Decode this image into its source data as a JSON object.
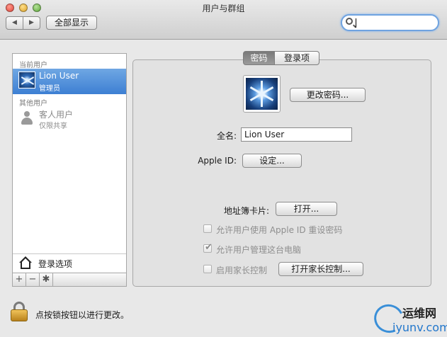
{
  "window": {
    "title": "用户与群组"
  },
  "toolbar": {
    "back": "◀",
    "forward": "▶",
    "show_all": "全部显示",
    "search_placeholder": ""
  },
  "sidebar": {
    "current_users_label": "当前用户",
    "other_users_label": "其他用户",
    "users": [
      {
        "name": "Lion User",
        "role": "管理员"
      },
      {
        "name": "客人用户",
        "role": "仅限共享"
      }
    ],
    "login_options": "登录选项",
    "add": "+",
    "remove": "−",
    "gear": "✱"
  },
  "tabs": {
    "password": "密码",
    "login_items": "登录项"
  },
  "form": {
    "change_password": "更改密码...",
    "full_name_label": "全名:",
    "full_name_value": "Lion User",
    "apple_id_label": "Apple ID:",
    "apple_id_button": "设定...",
    "address_card_label": "地址簿卡片:",
    "address_card_button": "打开...",
    "allow_reset": "允许用户使用 Apple ID 重设密码",
    "allow_admin": "允许用户管理这台电脑",
    "parental": "启用家长控制",
    "parental_button": "打开家长控制..."
  },
  "checkboxes": {
    "allow_reset": false,
    "allow_admin": true,
    "parental": false
  },
  "footer": {
    "lock_text": "点按锁按钮以进行更改。"
  },
  "watermark": {
    "top": "运维网",
    "bottom": "iyunv.com"
  }
}
